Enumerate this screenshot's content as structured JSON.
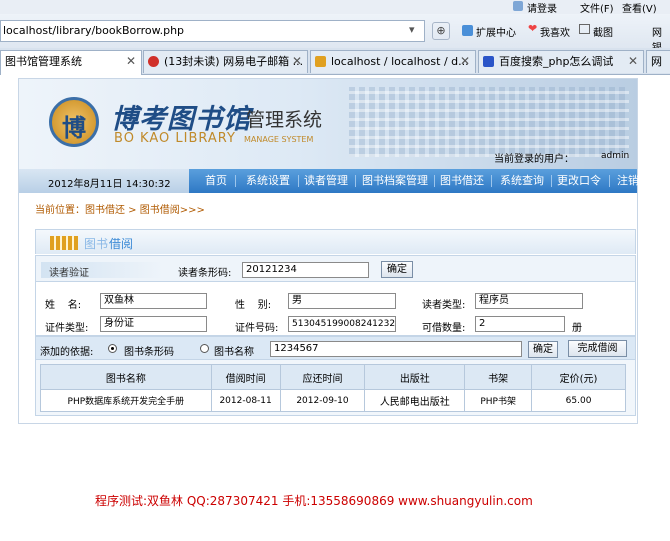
{
  "browser": {
    "top_right_links": [
      "请登录",
      "文件(F)",
      "查看(V)",
      "网银"
    ],
    "url": "localhost/library/bookBorrow.php",
    "toolbar": [
      "扩展中心",
      "我喜欢",
      "截图",
      "网银"
    ],
    "tabs": [
      {
        "label": "图书馆管理系统",
        "active": true
      },
      {
        "label": "(13封未读) 网易电子邮箱 ...",
        "active": false
      },
      {
        "label": "localhost / localhost / d...",
        "active": false
      },
      {
        "label": "百度搜索_php怎么调试",
        "active": false
      },
      {
        "label": "网",
        "active": false
      }
    ]
  },
  "header": {
    "logo_char": "博",
    "title_cn": "博考图书馆",
    "title_suffix": "管理系统",
    "title_en": "BO KAO LIBRARY",
    "subtitle_en": "MANAGE SYSTEM",
    "user_label": "当前登录的用户：",
    "user_name": "admin"
  },
  "nav": {
    "datetime": "2012年8月11日 14:30:32",
    "items": [
      "首页",
      "系统设置",
      "读者管理",
      "图书档案管理",
      "图书借还",
      "系统查询",
      "更改口令",
      "注销"
    ]
  },
  "breadcrumb": "当前位置：图书借还 > 图书借阅>>>",
  "panel": {
    "title_prefix": "图书",
    "title_suffix": "借阅"
  },
  "form": {
    "reader_verify": "读者验证",
    "barcode_label": "读者条形码:",
    "barcode_value": "20121234",
    "confirm": "确定",
    "name_label": "姓    名:",
    "name_value": "双鱼林",
    "gender_label": "性    别:",
    "gender_value": "男",
    "reader_type_label": "读者类型:",
    "reader_type_value": "程序员",
    "id_type_label": "证件类型:",
    "id_type_value": "身份证",
    "id_number_label": "证件号码:",
    "id_number_value": "513045199008241232",
    "borrow_count_label": "可借数量:",
    "borrow_count_value": "2",
    "borrow_count_unit": "册",
    "basis_label": "添加的依据:",
    "option_barcode": "图书条形码",
    "option_name": "图书名称",
    "search_value": "1234567",
    "search_confirm": "确定",
    "finish": "完成借阅"
  },
  "table": {
    "headers": [
      "图书名称",
      "借阅时间",
      "应还时间",
      "出版社",
      "书架",
      "定价(元)"
    ],
    "rows": [
      [
        "PHP数据库系统开发完全手册",
        "2012-08-11",
        "2012-09-10",
        "人民邮电出版社",
        "PHP书架",
        "65.00"
      ]
    ]
  },
  "footer": "程序测试:双鱼林 QQ:287307421 手机:13558690869 www.shuangyulin.com",
  "colors": {
    "nav": "#2e78c4",
    "breadcrumb": "#b05a00",
    "footer": "#cc0000",
    "panel_title": "#3b8ad6"
  }
}
